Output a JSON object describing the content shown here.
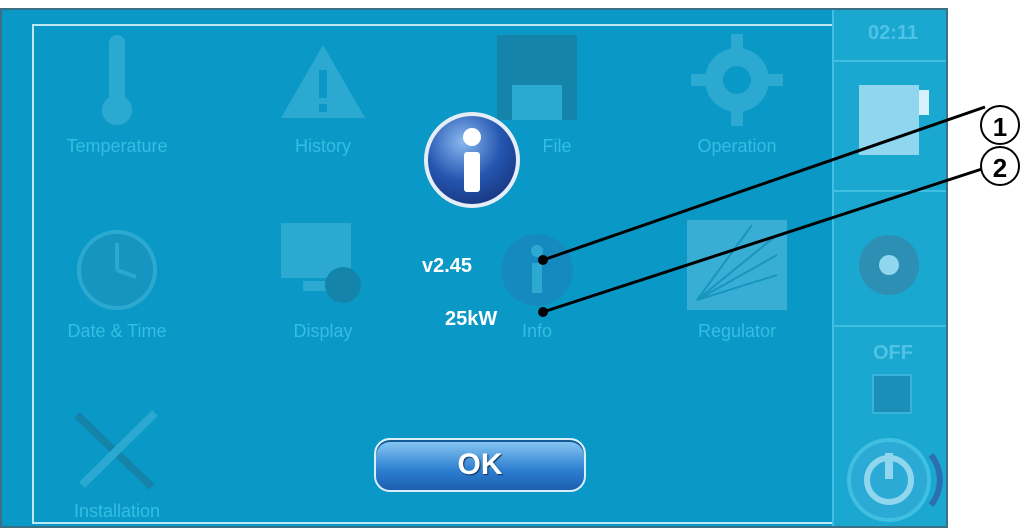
{
  "background_menu": {
    "items": [
      {
        "label": "Temperature",
        "icon": "thermometer-icon"
      },
      {
        "label": "History",
        "icon": "warning-icon"
      },
      {
        "label": "File",
        "icon": "floppy-disk-icon"
      },
      {
        "label": "Operation",
        "icon": "gear-icon"
      },
      {
        "label": "Date & Time",
        "icon": "clock-icon"
      },
      {
        "label": "Display",
        "icon": "display-settings-icon"
      },
      {
        "label": "Info",
        "icon": "info-icon"
      },
      {
        "label": "Regulator",
        "icon": "curve-chart-icon"
      },
      {
        "label": "Installation",
        "icon": "tools-icon"
      }
    ]
  },
  "side_panel": {
    "clock": "02:11",
    "status": "OFF"
  },
  "info_dialog": {
    "icon": "info-icon",
    "version": "v2.45",
    "power": "25kW",
    "ok_button": "OK"
  },
  "callouts": [
    "1",
    "2"
  ],
  "colors": {
    "screen_bg": "#0a99c6",
    "button_blue": "#2c7fd0",
    "text_white": "#ffffff",
    "callout_black": "#000000"
  }
}
